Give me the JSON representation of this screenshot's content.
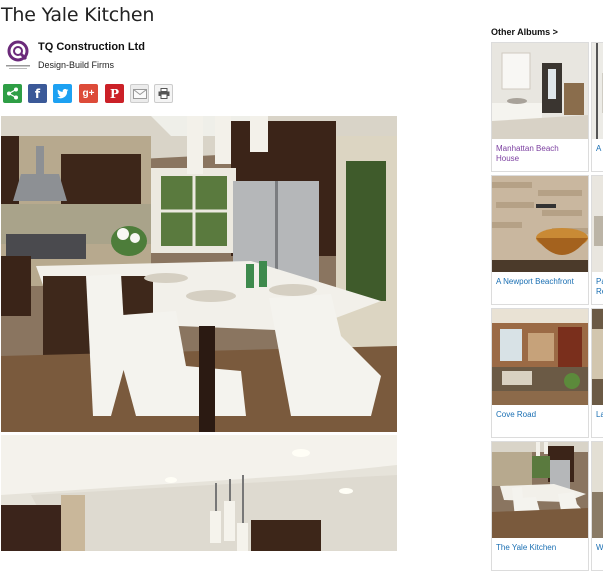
{
  "page": {
    "title": "The Yale Kitchen"
  },
  "company": {
    "name": "TQ Construction Ltd",
    "type": "Design-Build Firms"
  },
  "share": {
    "buttons": [
      {
        "name": "share",
        "icon": "share-icon",
        "color": "#2e9e45"
      },
      {
        "name": "facebook",
        "icon": "facebook-icon",
        "color": "#3b5998"
      },
      {
        "name": "twitter",
        "icon": "twitter-icon",
        "color": "#1da1f2"
      },
      {
        "name": "google-plus",
        "icon": "google-plus-icon",
        "color": "#dd4b39"
      },
      {
        "name": "pinterest",
        "icon": "pinterest-icon",
        "color": "#cb2027"
      },
      {
        "name": "email",
        "icon": "email-icon",
        "color": "#e0e0e0"
      },
      {
        "name": "print",
        "icon": "print-icon",
        "color": "#f2f2f2"
      }
    ]
  },
  "sidebar": {
    "heading": "Other Albums >",
    "albums": [
      {
        "label": "Manhattan Beach House",
        "visited": true
      },
      {
        "label": "A"
      },
      {
        "label": "A Newport Beachfront"
      },
      {
        "label": "Pa Re"
      },
      {
        "label": "Cove Road"
      },
      {
        "label": "La"
      },
      {
        "label": "The Yale Kitchen"
      },
      {
        "label": "W"
      }
    ]
  }
}
